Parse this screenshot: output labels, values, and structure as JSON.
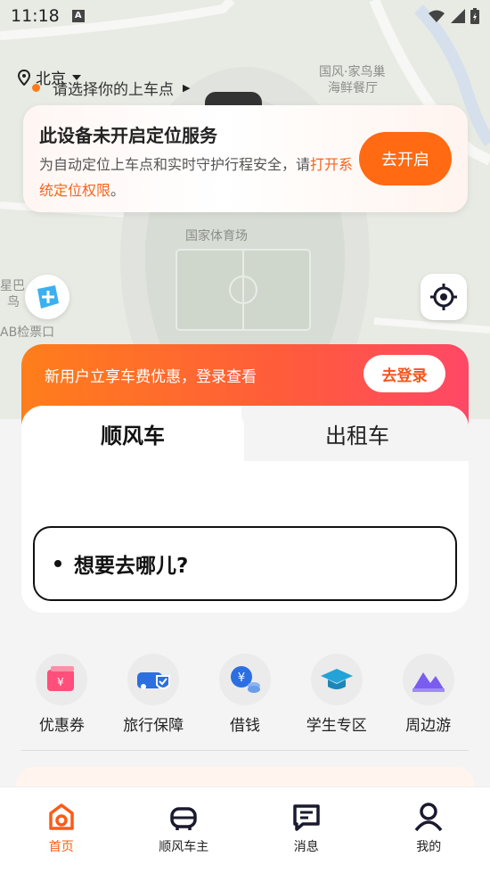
{
  "status_bar": {
    "time": "11:18",
    "indicator": "A"
  },
  "map": {
    "labels": [
      "国风·家鸟巢",
      "海鲜餐厅",
      "国家体育场",
      "星巴",
      "鸟",
      "AB检票口"
    ]
  },
  "city": {
    "name": "北京"
  },
  "location_card": {
    "title": "此设备未开启定位服务",
    "desc_normal": "为自动定位上车点和实时守护行程安全，请",
    "desc_link": "打开系统定位权限",
    "desc_end": "。",
    "button": "去开启"
  },
  "promo": {
    "text": "新用户立享车费优惠，登录查看",
    "button": "去登录"
  },
  "booking": {
    "tabs": [
      "顺风车",
      "出租车"
    ],
    "pickup_placeholder": "请选择你的上车点",
    "destination_placeholder": "想要去哪儿?"
  },
  "services": [
    {
      "label": "优惠券",
      "icon": "coupon-icon"
    },
    {
      "label": "旅行保障",
      "icon": "car-shield-icon"
    },
    {
      "label": "借钱",
      "icon": "yuan-coins-icon"
    },
    {
      "label": "学生专区",
      "icon": "graduation-cap-icon"
    },
    {
      "label": "周边游",
      "icon": "mountain-icon"
    }
  ],
  "bottom_nav": [
    {
      "label": "首页",
      "icon": "home-icon",
      "active": true
    },
    {
      "label": "顺风车主",
      "icon": "driver-icon",
      "active": false
    },
    {
      "label": "消息",
      "icon": "message-icon",
      "active": false
    },
    {
      "label": "我的",
      "icon": "profile-icon",
      "active": false
    }
  ],
  "colors": {
    "accent": "#ff6a12",
    "promo_start": "#ff7e1b",
    "promo_end": "#ff4866"
  }
}
